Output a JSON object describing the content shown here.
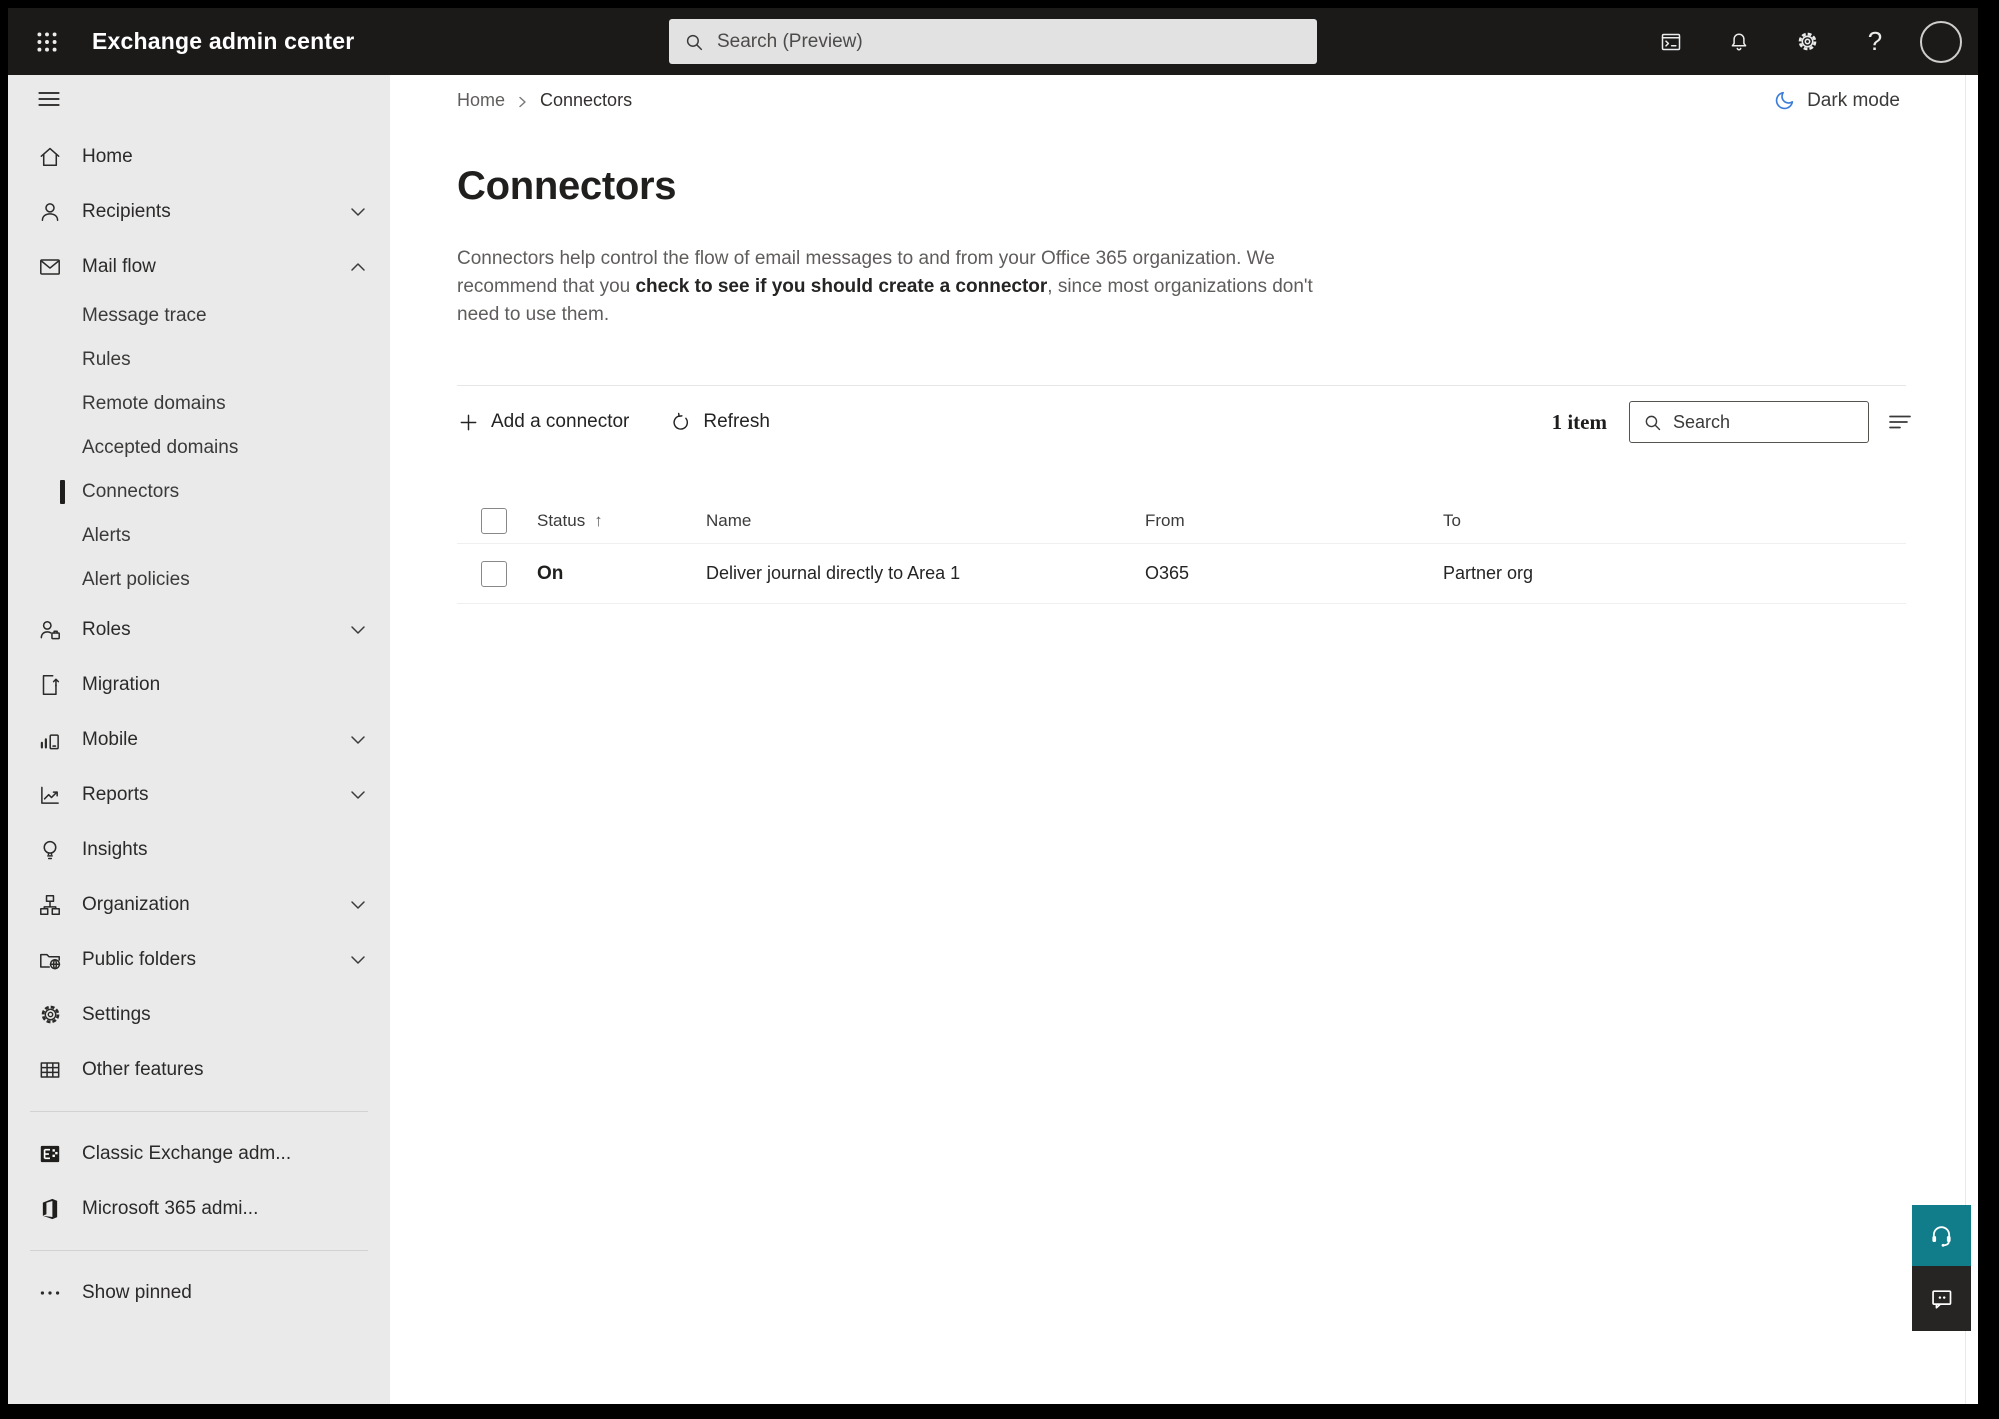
{
  "topbar": {
    "app_title": "Exchange admin center",
    "search_placeholder": "Search (Preview)",
    "help_glyph": "?"
  },
  "sidebar": {
    "items": [
      {
        "label": "Home",
        "icon": "home-icon"
      },
      {
        "label": "Recipients",
        "icon": "person-icon",
        "chevron": "down"
      },
      {
        "label": "Mail flow",
        "icon": "mail-icon",
        "chevron": "up",
        "expanded": true
      },
      {
        "label": "Message trace",
        "sub": true
      },
      {
        "label": "Rules",
        "sub": true
      },
      {
        "label": "Remote domains",
        "sub": true
      },
      {
        "label": "Accepted domains",
        "sub": true
      },
      {
        "label": "Connectors",
        "sub": true,
        "selected": true
      },
      {
        "label": "Alerts",
        "sub": true
      },
      {
        "label": "Alert policies",
        "sub": true
      },
      {
        "label": "Roles",
        "icon": "roles-icon",
        "chevron": "down"
      },
      {
        "label": "Migration",
        "icon": "migration-icon"
      },
      {
        "label": "Mobile",
        "icon": "mobile-icon",
        "chevron": "down"
      },
      {
        "label": "Reports",
        "icon": "reports-icon",
        "chevron": "down"
      },
      {
        "label": "Insights",
        "icon": "insights-icon"
      },
      {
        "label": "Organization",
        "icon": "organization-icon",
        "chevron": "down"
      },
      {
        "label": "Public folders",
        "icon": "public-folders-icon",
        "chevron": "down"
      },
      {
        "label": "Settings",
        "icon": "settings-icon"
      },
      {
        "label": "Other features",
        "icon": "other-features-icon"
      },
      {
        "label": "Classic Exchange adm...",
        "icon": "classic-exchange-icon"
      },
      {
        "label": "Microsoft 365 admi...",
        "icon": "microsoft-365-icon"
      },
      {
        "label": "Show pinned",
        "icon": "ellipsis-icon"
      }
    ]
  },
  "page": {
    "breadcrumb": {
      "home": "Home",
      "current": "Connectors"
    },
    "dark_mode_label": "Dark mode",
    "title": "Connectors",
    "description": {
      "part1": "Connectors help control the flow of email messages to and from your Office 365 organization. We recommend that you ",
      "link": "check to see if you should create a connector",
      "part2": ", since most organizations don't need to use them."
    },
    "toolbar": {
      "add_label": "Add a connector",
      "refresh_label": "Refresh",
      "item_count": "1 item",
      "search_placeholder": "Search"
    },
    "table": {
      "headers": [
        "Status",
        "Name",
        "From",
        "To"
      ],
      "sort_arrow": "↑",
      "rows": [
        {
          "status": "On",
          "name": "Deliver journal directly to Area 1",
          "from": "O365",
          "to": "Partner org"
        }
      ]
    }
  },
  "icons": {
    "app_launcher": "3x3-dot-grid",
    "terminal": "console-window",
    "bell": "notifications",
    "gear": "settings",
    "help": "question-mark",
    "avatar": "account-circle",
    "moon": "dark-mode-crescent",
    "headset": "support",
    "speech_bubble": "feedback",
    "filter": "filter-lines",
    "magnifier": "search"
  },
  "colors": {
    "topbar_bg": "#1b1a19",
    "sidebar_bg": "#eaeaea",
    "accent_teal": "#117d8a",
    "moon_blue": "#3b7dd8",
    "feedback_bg": "#262524",
    "selected_marker": "#1f1e1d"
  }
}
